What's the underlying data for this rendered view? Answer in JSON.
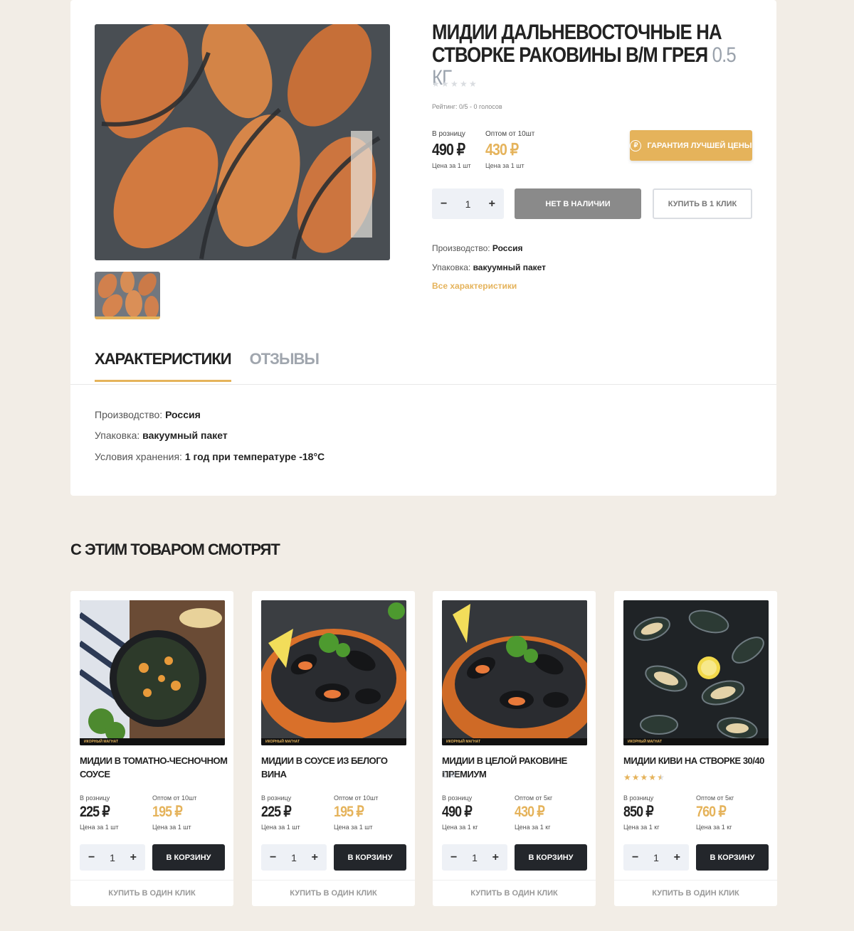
{
  "product": {
    "title": "Мидии дальневосточные на створке раковины в/м Грея",
    "weight": "0.5 кг",
    "rating_text": "Рейтинг: 0/5 - 0 голосов",
    "retail": {
      "label": "В розницу",
      "price": "490 ₽",
      "unit": "Цена за 1 шт"
    },
    "wholesale": {
      "label": "Оптом от 10шт",
      "price": "430 ₽",
      "unit": "Цена за 1 шт"
    },
    "guarantee_label": "Гарантия лучшей цены",
    "guarantee_icon": "₽",
    "quantity": "1",
    "minus": "−",
    "plus": "+",
    "out_of_stock_label": "Нет в наличии",
    "one_click_label": "Купить в 1 клик",
    "specs": [
      {
        "key": "Производство:",
        "value": "Россия"
      },
      {
        "key": "Упаковка:",
        "value": "вакуумный пакет"
      }
    ],
    "all_specs_link": "Все характеристики"
  },
  "tabs": [
    {
      "label": "Характеристики"
    },
    {
      "label": "Отзывы"
    }
  ],
  "characteristics": [
    {
      "key": "Производство:",
      "value": "Россия"
    },
    {
      "key": "Упаковка:",
      "value": "вакуумный пакет"
    },
    {
      "key": "Условия хранения:",
      "value": "1 год при температуре -18°C"
    }
  ],
  "related": {
    "title": "С этим товаром смотрят",
    "brand_strip": "ИКОРНЫЙ МАГНАТ",
    "cards": [
      {
        "name": "Мидии в томатно-чесночном соусе",
        "sub": "",
        "rating": null,
        "retail_label": "В розницу",
        "retail_price": "225 ₽",
        "retail_unit": "Цена за 1 шт",
        "wh_label": "Оптом от 10шт",
        "wh_price": "195 ₽",
        "wh_unit": "Цена за 1 шт",
        "qty": "1",
        "cart": "В корзину",
        "oneclick": "Купить в один клик"
      },
      {
        "name": "Мидии в соусе из белого вина",
        "sub": "",
        "rating": null,
        "retail_label": "В розницу",
        "retail_price": "225 ₽",
        "retail_unit": "Цена за 1 шт",
        "wh_label": "Оптом от 10шт",
        "wh_price": "195 ₽",
        "wh_unit": "Цена за 1 шт",
        "qty": "1",
        "cart": "В корзину",
        "oneclick": "Купить в один клик"
      },
      {
        "name": "Мидии в целой раковине премиум",
        "sub": "1 кг",
        "rating": null,
        "retail_label": "В розницу",
        "retail_price": "490 ₽",
        "retail_unit": "Цена за 1 кг",
        "wh_label": "Оптом от 5кг",
        "wh_price": "430 ₽",
        "wh_unit": "Цена за 1 кг",
        "qty": "1",
        "cart": "В корзину",
        "oneclick": "Купить в один клик"
      },
      {
        "name": "Мидии киви на створке 30/40",
        "sub": "",
        "rating": 4.5,
        "retail_label": "В розницу",
        "retail_price": "850 ₽",
        "retail_unit": "Цена за 1 кг",
        "wh_label": "Оптом от 5кг",
        "wh_price": "760 ₽",
        "wh_unit": "Цена за 1 кг",
        "qty": "1",
        "cart": "В корзину",
        "oneclick": "Купить в один клик"
      }
    ]
  },
  "colors": {
    "accent": "#e5b35b",
    "dark_button": "#23262b",
    "disabled_button": "#8a8a8a",
    "page_bg": "#f2ede6"
  }
}
